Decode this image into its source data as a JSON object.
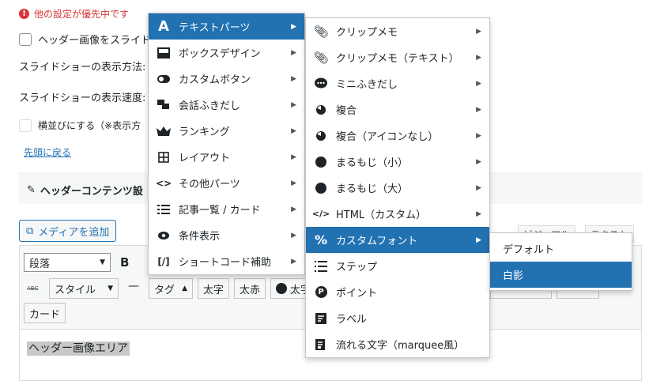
{
  "background": {
    "warning_text": "他の設定が優先中です",
    "header_slide_checkbox_label": "ヘッダー画像をスライド",
    "slideshow_method_label": "スライドショーの表示方法:",
    "slideshow_speed_label": "スライドショーの表示速度:",
    "horizontal_checkbox_label": "横並びにする（※表示方",
    "reset_link": "先頭に戻る",
    "section_title": "ヘッダーコンテンツ設",
    "media_button": "メディアを追加",
    "tab_visual": "ビジュアル",
    "tab_text": "テキスト",
    "format_select": "段落",
    "bold_button": "B",
    "style_select": "スタイル",
    "tag_button": "タグ",
    "futoji_button": "太字",
    "futoaka_button": "太赤",
    "futoji2_button": "太字",
    "card_button": "カード",
    "abc_label": "ABC",
    "dash_label": "—",
    "editor_content": "ヘッダー画像エリア"
  },
  "menu1": {
    "items": [
      {
        "label": "テキストパーツ",
        "icon": "letter-a-icon",
        "active": true
      },
      {
        "label": "ボックスデザイン",
        "icon": "box-icon"
      },
      {
        "label": "カスタムボタン",
        "icon": "toggle-icon"
      },
      {
        "label": "会話ふきだし",
        "icon": "chat-icon"
      },
      {
        "label": "ランキング",
        "icon": "crown-icon"
      },
      {
        "label": "レイアウト",
        "icon": "grid-icon"
      },
      {
        "label": "その他パーツ",
        "icon": "code-icon"
      },
      {
        "label": "記事一覧 / カード",
        "icon": "list-icon"
      },
      {
        "label": "条件表示",
        "icon": "eye-icon"
      },
      {
        "label": "ショートコード補助",
        "icon": "shortcode-icon"
      }
    ]
  },
  "menu2": {
    "items": [
      {
        "label": "クリップメモ",
        "icon": "paperclip-icon"
      },
      {
        "label": "クリップメモ（テキスト）",
        "icon": "paperclip-icon"
      },
      {
        "label": "ミニふきだし",
        "icon": "speech-bubble-icon"
      },
      {
        "label": "複合",
        "icon": "pie-icon"
      },
      {
        "label": "複合（アイコンなし）",
        "icon": "pie-icon"
      },
      {
        "label": "まるもじ（小）",
        "icon": "circle-icon"
      },
      {
        "label": "まるもじ（大）",
        "icon": "circle-icon"
      },
      {
        "label": "HTML（カスタム）",
        "icon": "code-icon"
      },
      {
        "label": "カスタムフォント",
        "icon": "percent-icon",
        "active": true
      },
      {
        "label": "ステップ",
        "icon": "steps-icon"
      },
      {
        "label": "ポイント",
        "icon": "point-icon"
      },
      {
        "label": "ラベル",
        "icon": "label-icon"
      },
      {
        "label": "流れる文字（marquee風）",
        "icon": "marquee-icon"
      }
    ]
  },
  "menu3": {
    "items": [
      {
        "label": "デフォルト"
      },
      {
        "label": "白影",
        "active": true
      }
    ]
  },
  "colors": {
    "accent": "#2271b1",
    "warning": "#d63638"
  }
}
